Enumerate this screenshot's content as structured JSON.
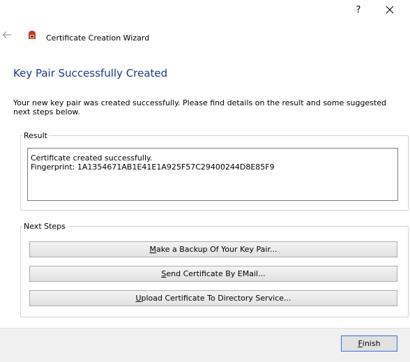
{
  "titlebar": {
    "help_label": "?",
    "close_label": "×"
  },
  "wizard": {
    "title": "Certificate Creation Wizard",
    "back_icon": "back-arrow-icon",
    "app_icon": "certificate-app-icon",
    "app_icon_color": "#c0392b"
  },
  "page": {
    "heading": "Key Pair Successfully Created",
    "description": "Your new key pair was created successfully. Please find details on the result and some suggested next steps below.",
    "heading_color": "#1c3a8a"
  },
  "result": {
    "legend": "Result",
    "lines": [
      "Certificate created successfully.",
      "Fingerprint: 1A1354671AB1E41E1A925F57C29400244D8E85F9"
    ]
  },
  "next_steps": {
    "legend": "Next Steps",
    "buttons": [
      {
        "accel": "M",
        "rest": "ake a Backup Of Your Key Pair..."
      },
      {
        "accel": "S",
        "rest": "end Certificate By EMail..."
      },
      {
        "accel": "U",
        "rest": "pload Certificate To Directory Service..."
      }
    ]
  },
  "footer": {
    "finish_accel": "F",
    "finish_rest": "inish"
  }
}
